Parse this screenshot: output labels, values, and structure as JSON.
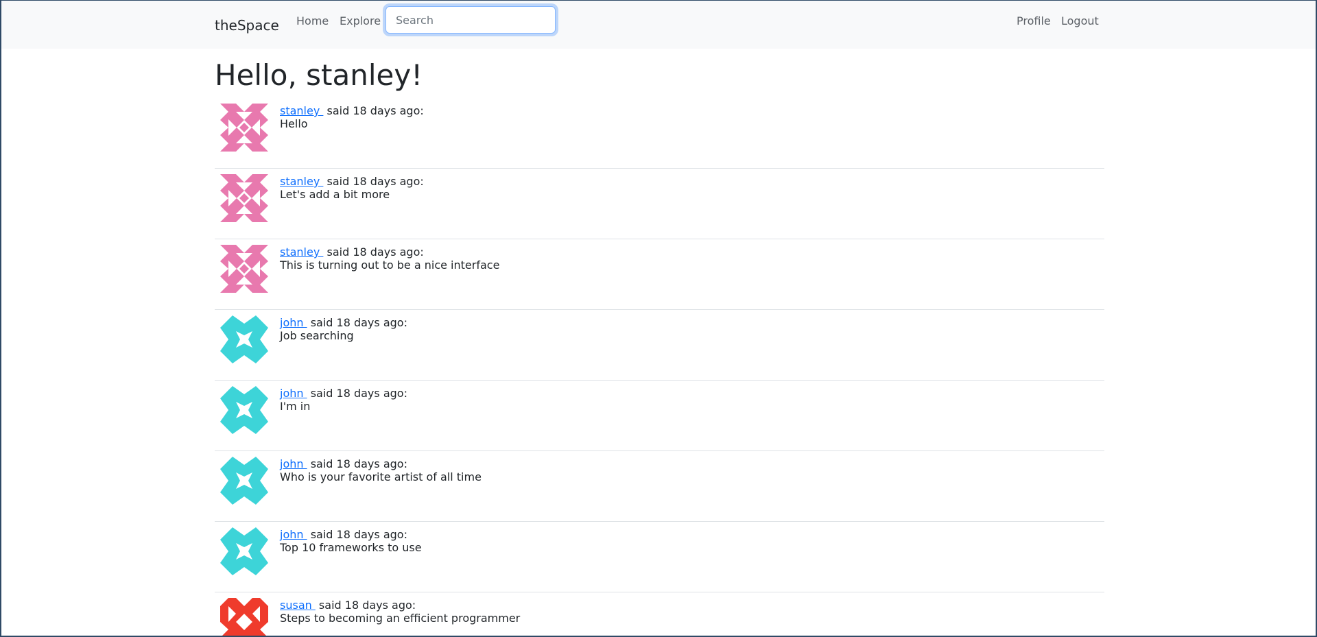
{
  "navbar": {
    "brand": "theSpace",
    "links": {
      "home": "Home",
      "explore": "Explore",
      "profile": "Profile",
      "logout": "Logout"
    },
    "search_placeholder": "Search"
  },
  "page": {
    "title": "Hello, stanley!"
  },
  "posts": [
    {
      "user": "stanley",
      "meta": " said 18 days ago:",
      "body": "Hello",
      "avatar_color": "#e879ae",
      "avatar_icon": "identicon-stanley"
    },
    {
      "user": "stanley",
      "meta": " said 18 days ago:",
      "body": "Let's add a bit more",
      "avatar_color": "#e879ae",
      "avatar_icon": "identicon-stanley"
    },
    {
      "user": "stanley",
      "meta": " said 18 days ago:",
      "body": "This is turning out to be a nice interface",
      "avatar_color": "#e879ae",
      "avatar_icon": "identicon-stanley"
    },
    {
      "user": "john",
      "meta": " said 18 days ago:",
      "body": "Job searching",
      "avatar_color": "#3dd4d8",
      "avatar_icon": "identicon-john"
    },
    {
      "user": "john",
      "meta": " said 18 days ago:",
      "body": "I'm in",
      "avatar_color": "#3dd4d8",
      "avatar_icon": "identicon-john"
    },
    {
      "user": "john",
      "meta": " said 18 days ago:",
      "body": "Who is your favorite artist of all time",
      "avatar_color": "#3dd4d8",
      "avatar_icon": "identicon-john"
    },
    {
      "user": "john",
      "meta": " said 18 days ago:",
      "body": "Top 10 frameworks to use",
      "avatar_color": "#3dd4d8",
      "avatar_icon": "identicon-john"
    },
    {
      "user": "susan",
      "meta": " said 18 days ago:",
      "body": "Steps to becoming an efficient programmer",
      "avatar_color": "#ef3b2c",
      "avatar_icon": "identicon-susan"
    }
  ]
}
